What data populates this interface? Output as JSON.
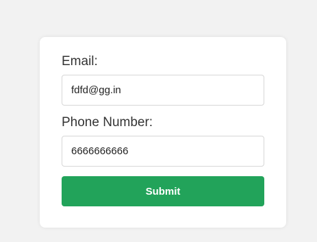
{
  "form": {
    "email_label": "Email:",
    "email_value": "fdfd@gg.in",
    "phone_label": "Phone Number:",
    "phone_value": "6666666666",
    "submit_label": "Submit"
  },
  "colors": {
    "background": "#f2f2f2",
    "card": "#ffffff",
    "submit_button": "#22a35a",
    "submit_text": "#ffffff",
    "label_text": "#333333",
    "field_border": "#d6d6d6"
  }
}
